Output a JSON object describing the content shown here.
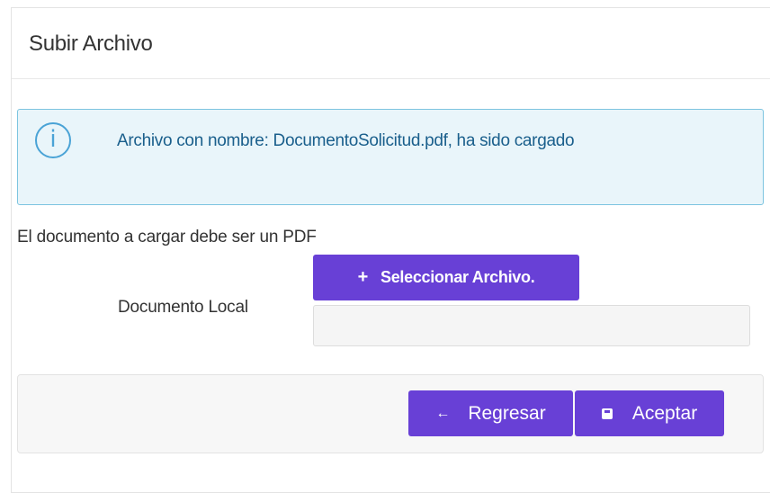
{
  "panel": {
    "title": "Subir Archivo"
  },
  "alert": {
    "icon": "info-icon",
    "icon_glyph": "i",
    "message": "Archivo con nombre: DocumentoSolicitud.pdf, ha sido cargado",
    "colors": {
      "background": "#e9f5fa",
      "border": "#7cc4e0",
      "text": "#1a5f8c"
    }
  },
  "form": {
    "hint": "El documento a cargar debe ser un PDF",
    "field_label": "Documento Local",
    "select_button": {
      "icon": "plus-icon",
      "icon_glyph": "+",
      "label": "Seleccionar Archivo."
    },
    "file_value": ""
  },
  "footer": {
    "back_button": {
      "icon": "arrow-left-icon",
      "icon_glyph": "←",
      "label": "Regresar"
    },
    "accept_button": {
      "icon": "save-icon",
      "label": "Aceptar"
    }
  },
  "colors": {
    "accent": "#6840d6"
  }
}
